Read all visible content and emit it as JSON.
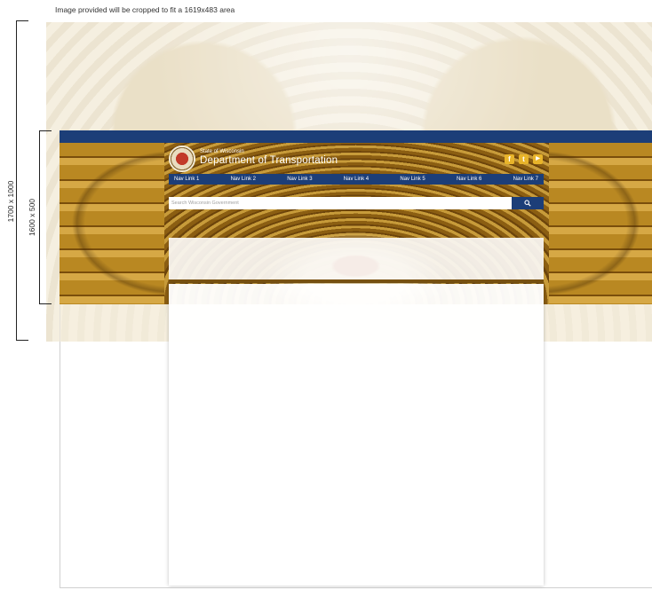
{
  "caption": "Image provided will be cropped to fit a 1619x483 area",
  "dimensions": {
    "outer_label": "1700 x 1000",
    "inner_label": "1600 x 500"
  },
  "header": {
    "state_name": "State of Wisconsin",
    "department_name": "Department of Transportation"
  },
  "social": [
    {
      "icon": "facebook-icon",
      "glyph": "f"
    },
    {
      "icon": "twitter-icon",
      "glyph": "t"
    },
    {
      "icon": "youtube-icon",
      "glyph": "▶"
    }
  ],
  "nav": {
    "links": [
      "Nav Link 1",
      "Nav Link 2",
      "Nav Link 3",
      "Nav Link 4",
      "Nav Link 5",
      "Nav Link 6",
      "Nav Link 7"
    ]
  },
  "search": {
    "placeholder": "Search Wisconsin Government",
    "button_icon": "search-icon"
  },
  "colors": {
    "brand_blue": "#1c3e78",
    "social_gold": "#e8b42a"
  }
}
